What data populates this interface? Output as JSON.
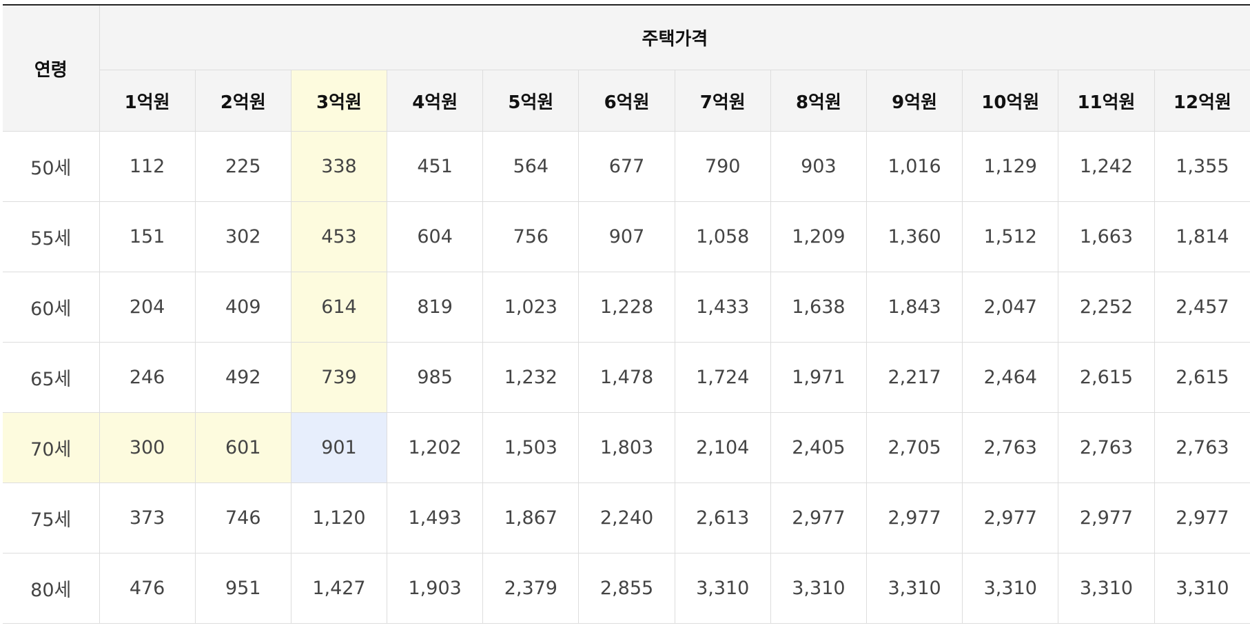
{
  "table": {
    "age_header": "연령",
    "group_header": "주택가격",
    "price_headers": [
      "1억원",
      "2억원",
      "3억원",
      "4억원",
      "5억원",
      "6억원",
      "7억원",
      "8억원",
      "9억원",
      "10억원",
      "11억원",
      "12억원"
    ],
    "highlight": {
      "column_color": "#fdfbde",
      "row_color": "#fdfbde",
      "intersection_color": "#e7eefc",
      "highlight_column_index": 2,
      "highlight_row_index": 4
    },
    "rows": [
      {
        "age": "50세",
        "values": [
          "112",
          "225",
          "338",
          "451",
          "564",
          "677",
          "790",
          "903",
          "1,016",
          "1,129",
          "1,242",
          "1,355"
        ]
      },
      {
        "age": "55세",
        "values": [
          "151",
          "302",
          "453",
          "604",
          "756",
          "907",
          "1,058",
          "1,209",
          "1,360",
          "1,512",
          "1,663",
          "1,814"
        ]
      },
      {
        "age": "60세",
        "values": [
          "204",
          "409",
          "614",
          "819",
          "1,023",
          "1,228",
          "1,433",
          "1,638",
          "1,843",
          "2,047",
          "2,252",
          "2,457"
        ]
      },
      {
        "age": "65세",
        "values": [
          "246",
          "492",
          "739",
          "985",
          "1,232",
          "1,478",
          "1,724",
          "1,971",
          "2,217",
          "2,464",
          "2,615",
          "2,615"
        ]
      },
      {
        "age": "70세",
        "values": [
          "300",
          "601",
          "901",
          "1,202",
          "1,503",
          "1,803",
          "2,104",
          "2,405",
          "2,705",
          "2,763",
          "2,763",
          "2,763"
        ]
      },
      {
        "age": "75세",
        "values": [
          "373",
          "746",
          "1,120",
          "1,493",
          "1,867",
          "2,240",
          "2,613",
          "2,977",
          "2,977",
          "2,977",
          "2,977",
          "2,977"
        ]
      },
      {
        "age": "80세",
        "values": [
          "476",
          "951",
          "1,427",
          "1,903",
          "2,379",
          "2,855",
          "3,310",
          "3,310",
          "3,310",
          "3,310",
          "3,310",
          "3,310"
        ]
      }
    ]
  }
}
